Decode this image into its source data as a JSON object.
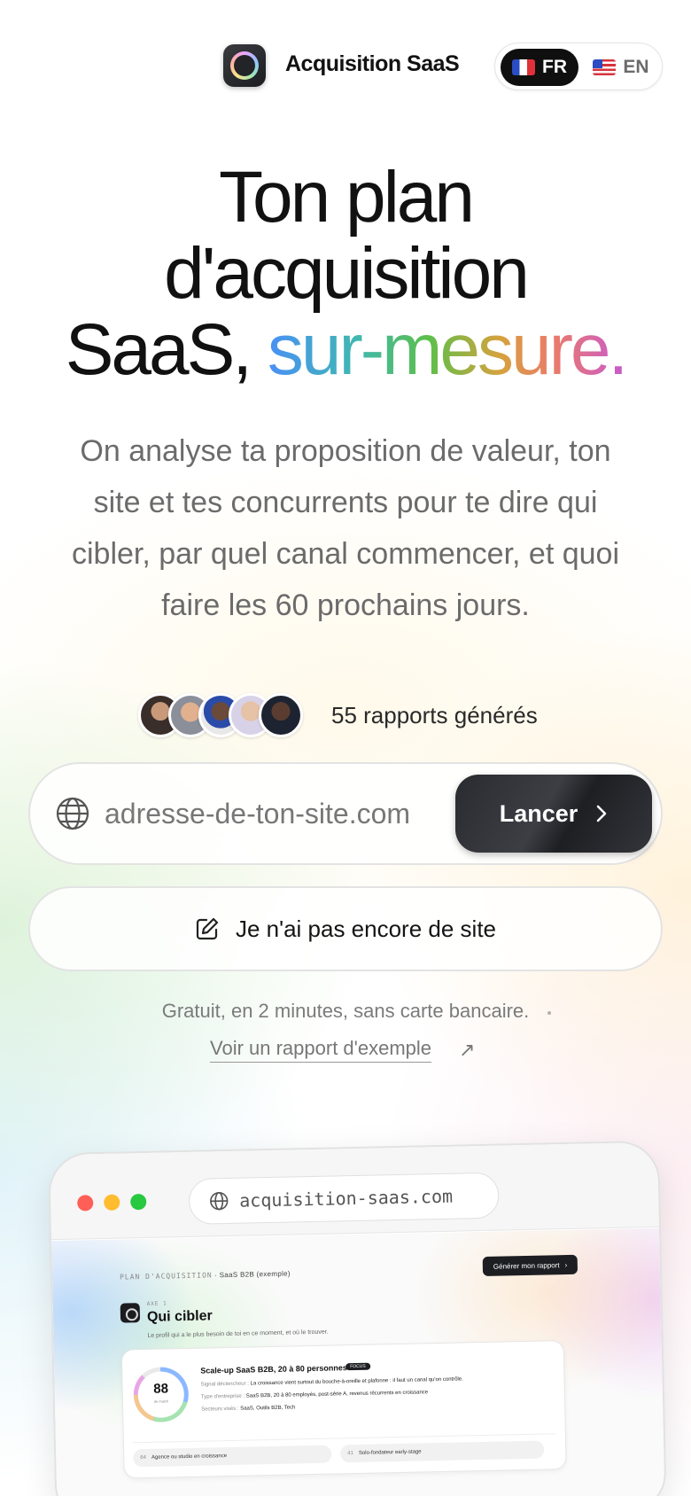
{
  "header": {
    "brand": "Acquisition SaaS",
    "lang": {
      "fr_label": "FR",
      "en_label": "EN",
      "active": "FR"
    }
  },
  "hero": {
    "title_line1": "Ton plan",
    "title_line2": "d'acquisition",
    "title_line3_plain": "SaaS,",
    "title_line3_accent": "sur-mesure.",
    "subtitle": "On analyse ta proposition de valeur, ton site et tes concurrents pour te dire qui cibler, par quel canal commencer, et quoi faire les 60 prochains jours."
  },
  "social_proof": {
    "text": "55 rapports générés",
    "avatar_count": 5
  },
  "url_form": {
    "placeholder": "adresse-de-ton-site.com",
    "value": "",
    "launch_label": "Lancer"
  },
  "no_site": {
    "label": "Je n'ai pas encore de site"
  },
  "meta": {
    "note": "Gratuit, en 2 minutes, sans carte bancaire.",
    "example_link": "Voir un rapport d'exemple"
  },
  "preview": {
    "address": "acquisition-saas.com",
    "crumb_label": "PLAN D'ACQUISITION",
    "crumb_sep": "·",
    "crumb_value": "SaaS B2B (exemple)",
    "generate_label": "Générer mon rapport",
    "step_label": "AXE 1",
    "step_title": "Qui cibler",
    "step_desc": "Le profil qui a le plus besoin de toi en ce moment, et où le trouver.",
    "score": "88",
    "score_sub": "de match",
    "segment_title": "Scale-up SaaS B2B, 20 à 80 personnes",
    "segment_badge": "FOCUS",
    "rows": [
      {
        "key": "Signal déclencheur :",
        "value": "La croissance vient surtout du bouche-à-oreille et plafonne : il faut un canal qu'on contrôle."
      },
      {
        "key": "Type d'entreprise :",
        "value": "SaaS B2B, 20 à 80 employés, post-série A, revenus récurrents en croissance"
      },
      {
        "key": "Secteurs visés :",
        "value": "SaaS, Outils B2B, Tech"
      }
    ],
    "chips": [
      {
        "score": "64",
        "label": "Agence ou studio en croissance"
      },
      {
        "score": "41",
        "label": "Solo-fondateur early-stage"
      }
    ]
  }
}
